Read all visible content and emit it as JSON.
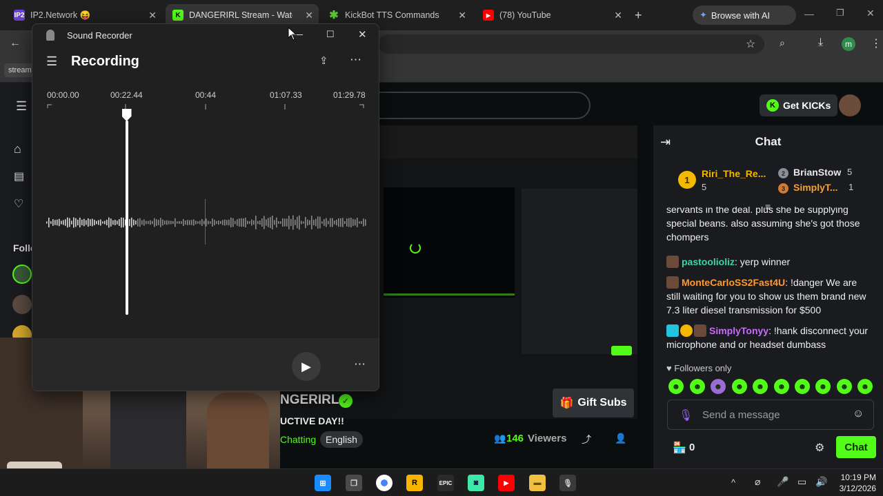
{
  "browser": {
    "tabs": [
      {
        "title": "IP2.Network 😝",
        "fav": "IP2",
        "fav_color": "#6a3fd1"
      },
      {
        "title": "DANGERIRL Stream - Watch L",
        "fav": "K",
        "fav_color": "#53fc18"
      },
      {
        "title": "KickBot TTS Commands",
        "fav": "✱",
        "fav_color": "#5fc93a"
      },
      {
        "title": "(78) YouTube",
        "fav": "▶",
        "fav_color": "#ff0000"
      }
    ],
    "new_tab": "+",
    "browse_ai": "Browse with AI",
    "bookmark_label": "stream",
    "profile_initial": "m"
  },
  "recorder": {
    "app_title": "Sound Recorder",
    "heading": "Recording",
    "timestamps": [
      "00:00.00",
      "00:22.44",
      "00:44",
      "01:07.33",
      "01:29.78"
    ],
    "position_fraction": 0.25
  },
  "kick": {
    "get_kicks": "Get KICKs",
    "following_label": "Follo",
    "streamer_name": "NGERIRL",
    "stream_title": "UCTIVE DAY!!",
    "category": "Chatting",
    "language": "English",
    "viewers_count": "146",
    "viewers_label": "Viewers",
    "gift_subs": "Gift Subs",
    "chat": {
      "title": "Chat",
      "leaders": [
        {
          "rank": "1",
          "name": "Riri_The_Re...",
          "count": "5"
        },
        {
          "rank": "2",
          "name": "BrianStow",
          "count": "5"
        },
        {
          "rank": "3",
          "name": "SimplyT...",
          "count": "1"
        }
      ],
      "partial_line": "servants in the deal. plus she be supplying special beans. also assuming she's got those chompers",
      "messages": [
        {
          "user": "pastoolioliz",
          "color": "#3fd6a0",
          "text": "yerp winner"
        },
        {
          "user": "MonteCarloSS2Fast4U",
          "color": "#ff9a2e",
          "text": "!danger We are still waiting for you to show us them brand new 7.3 liter diesel transmission for $500"
        },
        {
          "user": "SimplyTonyy",
          "color": "#c96bff",
          "text": "!hank disconnect your microphone and or headset dumbass"
        }
      ],
      "followers_only": "Followers only",
      "input_placeholder": "Send a message",
      "points": "0",
      "send_label": "Chat"
    }
  },
  "taskbar": {
    "time": "10:19 PM",
    "date": "3/12/2026"
  }
}
